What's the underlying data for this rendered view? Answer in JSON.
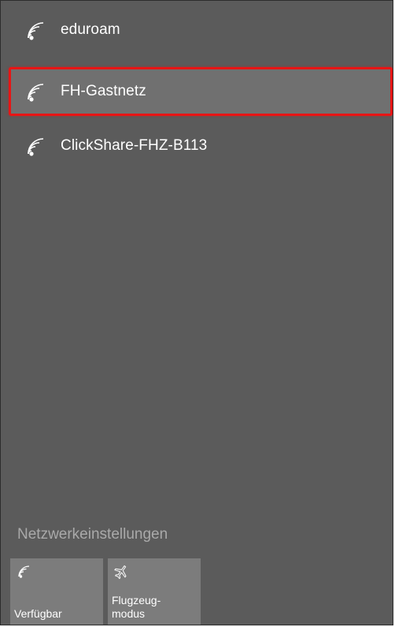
{
  "networks": [
    {
      "name": "eduroam",
      "icon": "wifi-icon",
      "selected": false
    },
    {
      "name": "FH-Gastnetz",
      "icon": "wifi-icon",
      "selected": true
    },
    {
      "name": "ClickShare-FHZ-B113",
      "icon": "wifi-icon",
      "selected": false
    }
  ],
  "footer": {
    "settings_link": "Netzwerkeinstellungen",
    "tiles": [
      {
        "label": "Verfügbar",
        "icon": "wifi-icon"
      },
      {
        "label": "Flugzeug-\nmodus",
        "icon": "airplane-icon"
      }
    ]
  },
  "colors": {
    "panel_background": "#5b5b5b",
    "selected_item_background": "#707070",
    "selection_highlight_border": "#e81515",
    "tile_background": "#7c7c7c",
    "settings_link_text": "#a9a9a9",
    "text": "#ffffff"
  }
}
